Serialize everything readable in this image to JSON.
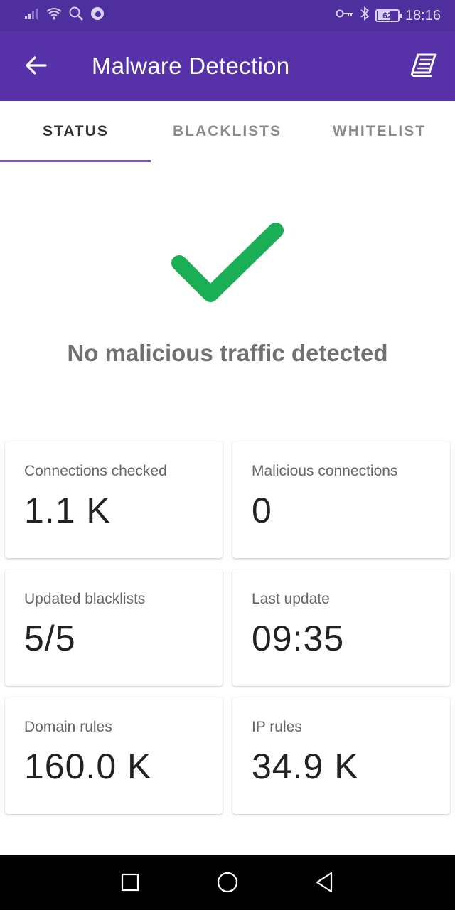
{
  "status_bar": {
    "time": "18:16",
    "battery": "62",
    "icons": [
      "signal-icon",
      "wifi-icon",
      "search-icon",
      "firefox-icon",
      "key-icon",
      "bluetooth-icon",
      "battery-icon"
    ]
  },
  "app_bar": {
    "title": "Malware Detection",
    "back_icon": "arrow-left-icon",
    "action_icon": "book-icon"
  },
  "tabs": [
    {
      "label": "STATUS",
      "active": true
    },
    {
      "label": "BLACKLISTS",
      "active": false
    },
    {
      "label": "WHITELIST",
      "active": false
    }
  ],
  "status": {
    "icon": "check-icon",
    "message": "No malicious traffic detected",
    "icon_color": "#1aaf54"
  },
  "cards": [
    {
      "label": "Connections checked",
      "value": "1.1 K"
    },
    {
      "label": "Malicious connections",
      "value": "0"
    },
    {
      "label": "Updated blacklists",
      "value": "5/5"
    },
    {
      "label": "Last update",
      "value": "09:35"
    },
    {
      "label": "Domain rules",
      "value": "160.0 K"
    },
    {
      "label": "IP rules",
      "value": "34.9 K"
    }
  ],
  "colors": {
    "status_bar": "#4f2e9e",
    "app_bar": "#5631a8",
    "tab_indicator": "#7a5cbf",
    "accent_green": "#1aaf54"
  },
  "nav": {
    "icons": [
      "square-recents-icon",
      "circle-home-icon",
      "triangle-back-icon"
    ]
  }
}
